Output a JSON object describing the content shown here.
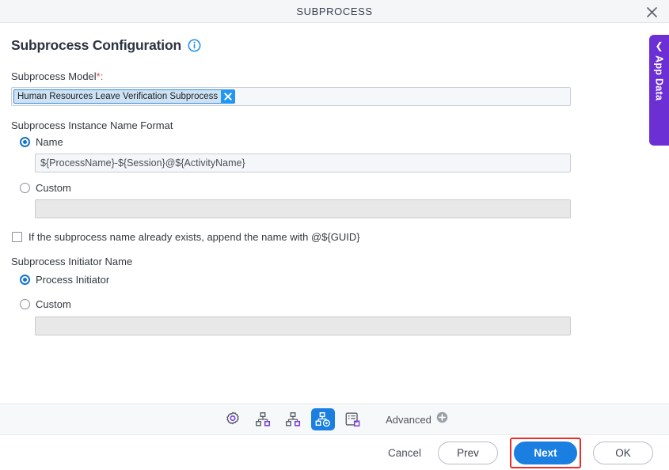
{
  "window": {
    "title": "SUBPROCESS",
    "close_icon": "close-icon"
  },
  "page": {
    "heading": "Subprocess Configuration",
    "info_icon": "info-icon"
  },
  "model_field": {
    "label": "Subprocess Model",
    "required_marker": "*:",
    "chip_value": "Human Resources Leave Verification Subprocess",
    "chip_remove_icon": "close-icon"
  },
  "name_format": {
    "section_label": "Subprocess Instance Name Format",
    "options": [
      {
        "label": "Name",
        "selected": true
      },
      {
        "label": "Custom",
        "selected": false
      }
    ],
    "name_value": "${ProcessName}-${Session}@${ActivityName}",
    "custom_value": "",
    "custom_placeholder": ""
  },
  "guid_checkbox": {
    "label": "If the subprocess name already exists, append the name with @${GUID}",
    "checked": false
  },
  "initiator": {
    "section_label": "Subprocess Initiator Name",
    "options": [
      {
        "label": "Process Initiator",
        "selected": true
      },
      {
        "label": "Custom",
        "selected": false
      }
    ],
    "custom_value": "",
    "custom_placeholder": ""
  },
  "toolbar": {
    "items": [
      {
        "name": "general-settings-icon",
        "active": false
      },
      {
        "name": "subprocess-nodes-icon",
        "active": false
      },
      {
        "name": "subprocess-mapping-icon",
        "active": false
      },
      {
        "name": "subprocess-configuration-icon",
        "active": true
      },
      {
        "name": "form-fields-icon",
        "active": false
      }
    ],
    "advanced_label": "Advanced",
    "advanced_icon": "plus-circle-icon"
  },
  "footer": {
    "cancel_label": "Cancel",
    "prev_label": "Prev",
    "next_label": "Next",
    "ok_label": "OK"
  },
  "app_data_tab": {
    "label": "App Data",
    "chevron_icon": "chevron-left-icon"
  },
  "colors": {
    "accent_blue": "#1a7fe0",
    "purple": "#6b2fd4",
    "highlight_red": "#ee2b24",
    "title_text": "#38414f"
  }
}
